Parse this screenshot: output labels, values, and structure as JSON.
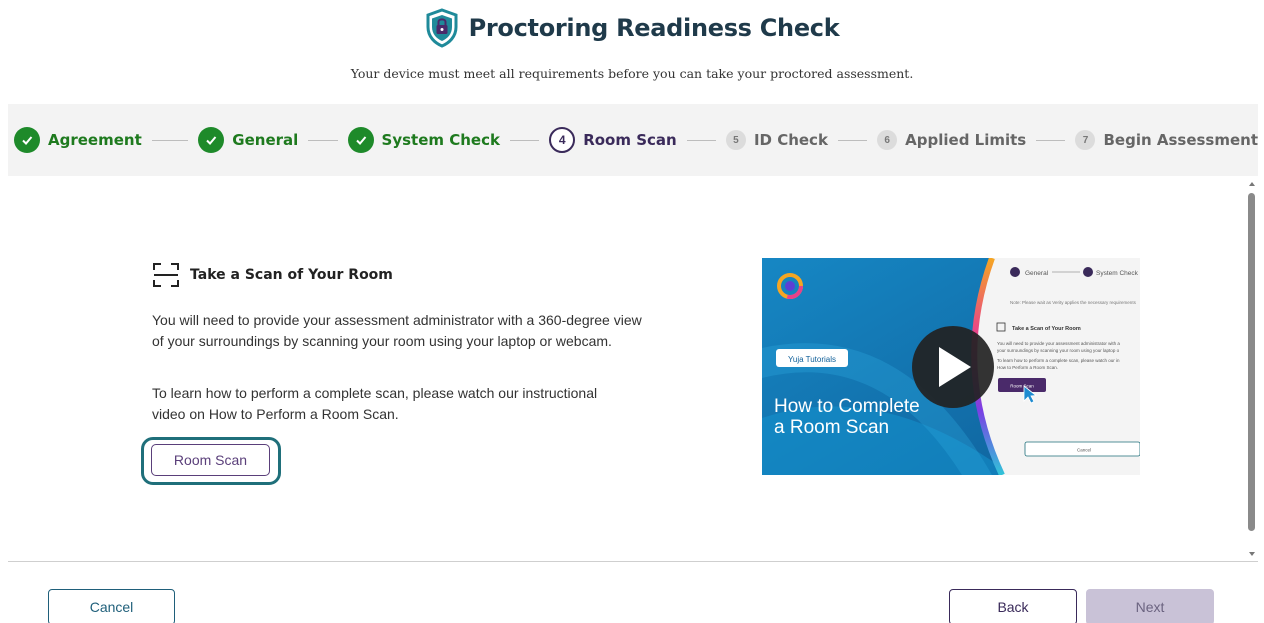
{
  "header": {
    "title": "Proctoring Readiness Check",
    "subtitle": "Your device must meet all requirements before you can take your proctored assessment."
  },
  "steps": [
    {
      "label": "Agreement",
      "status": "complete"
    },
    {
      "label": "General",
      "status": "complete"
    },
    {
      "label": "System Check",
      "status": "complete"
    },
    {
      "number": "4",
      "label": "Room Scan",
      "status": "current"
    },
    {
      "number": "5",
      "label": "ID Check",
      "status": "pending"
    },
    {
      "number": "6",
      "label": "Applied Limits",
      "status": "pending"
    },
    {
      "number": "7",
      "label": "Begin Assessment",
      "status": "pending"
    }
  ],
  "scan": {
    "heading": "Take a Scan of Your Room",
    "paragraph1": "You will need to provide your assessment administrator with a 360-degree view of your surroundings by scanning your room using your laptop or webcam.",
    "paragraph2": "To learn how to perform a complete scan, please watch our instructional video on How to Perform a Room Scan.",
    "button": "Room Scan"
  },
  "video": {
    "badge": "Yuja Tutorials",
    "title_line1": "How to Complete",
    "title_line2": "a Room Scan",
    "mini_step1": "General",
    "mini_step2": "System Check",
    "mini_note": "Note: Please wait as Verity applies the necessary requirements",
    "mini_heading": "Take a Scan of Your Room",
    "mini_text1": "You will need to provide your assessment administrator with a",
    "mini_text2": "your surroundings by scanning your room using your laptop o",
    "mini_text3": "To learn how to perform a complete scan, please watch our in",
    "mini_text4": "How to Perform a Room Scan.",
    "mini_button": "Room Scan",
    "mini_cancel": "Cancel"
  },
  "footer": {
    "cancel": "Cancel",
    "back": "Back",
    "next": "Next"
  },
  "colors": {
    "complete": "#1e8a2a",
    "current": "#3a2a5a",
    "title": "#1f3a4a",
    "accent_teal": "#1f6f7a",
    "next_disabled": "#c9c2d7"
  }
}
